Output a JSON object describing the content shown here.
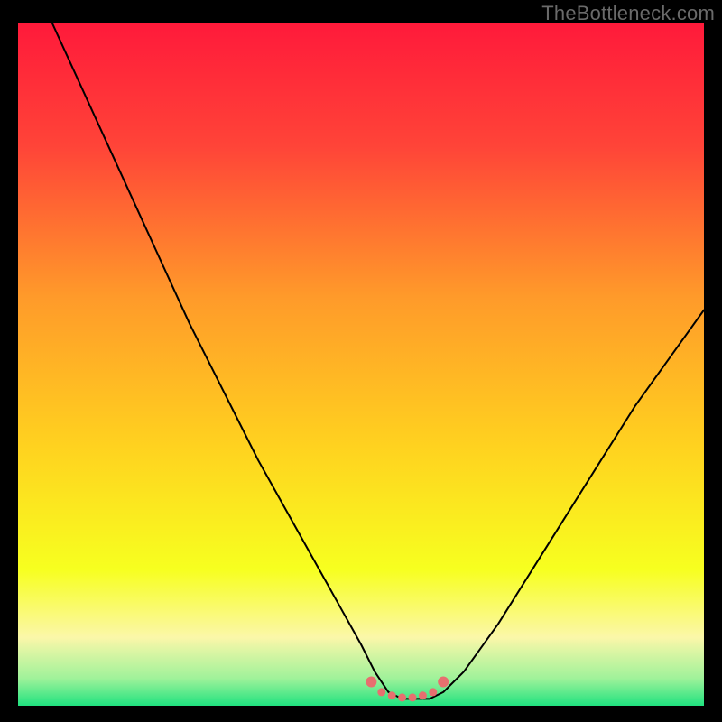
{
  "watermark": "TheBottleneck.com",
  "colors": {
    "frame": "#000000",
    "curve": "#000000",
    "markers": "#e76f6f",
    "green_band": "#1fe27f",
    "yellow_band_top": "#fbf7a9"
  },
  "chart_data": {
    "type": "line",
    "title": "",
    "xlabel": "",
    "ylabel": "",
    "xlim": [
      0,
      100
    ],
    "ylim": [
      0,
      100
    ],
    "grid": false,
    "legend": false,
    "series": [
      {
        "name": "bottleneck-curve",
        "x": [
          5,
          10,
          15,
          20,
          25,
          30,
          35,
          40,
          45,
          50,
          52,
          54,
          56,
          58,
          60,
          62,
          65,
          70,
          75,
          80,
          85,
          90,
          95,
          100
        ],
        "y": [
          100,
          89,
          78,
          67,
          56,
          46,
          36,
          27,
          18,
          9,
          5,
          2,
          1,
          1,
          1,
          2,
          5,
          12,
          20,
          28,
          36,
          44,
          51,
          58
        ]
      }
    ],
    "markers": {
      "name": "highlight-dots",
      "x": [
        51.5,
        53,
        54.5,
        56,
        57.5,
        59,
        60.5,
        62
      ],
      "y": [
        3.5,
        2.0,
        1.5,
        1.2,
        1.2,
        1.5,
        2.0,
        3.5
      ]
    },
    "gradient_stops": [
      {
        "pct": 0,
        "color": "#ff1a3a"
      },
      {
        "pct": 18,
        "color": "#ff4438"
      },
      {
        "pct": 40,
        "color": "#ff9a2a"
      },
      {
        "pct": 62,
        "color": "#ffd21f"
      },
      {
        "pct": 80,
        "color": "#f7ff1f"
      },
      {
        "pct": 90,
        "color": "#fbf7a9"
      },
      {
        "pct": 96,
        "color": "#9ff29a"
      },
      {
        "pct": 100,
        "color": "#1fe27f"
      }
    ]
  }
}
